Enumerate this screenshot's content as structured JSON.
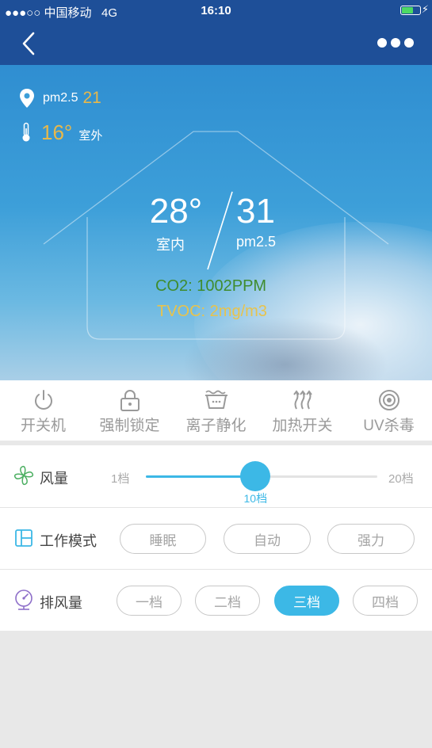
{
  "status_bar": {
    "carrier": "●●●○○ 中国移动",
    "network": "4G",
    "time": "16:10"
  },
  "nav": {
    "back_icon": "chevron-left-icon",
    "more_icon": "more-dots-icon"
  },
  "outdoor": {
    "pm_label": "pm2.5",
    "pm_value": "21",
    "temp_value": "16°",
    "temp_label": "室外"
  },
  "indoor": {
    "temp_value": "28°",
    "temp_label": "室内",
    "pm_value": "31",
    "pm_label": "pm2.5",
    "co2": "CO2: 1002PPM",
    "tvoc": "TVOC: 2mg/m3"
  },
  "toolbar": {
    "items": [
      {
        "label": "开关机",
        "icon": "power-icon"
      },
      {
        "label": "强制锁定",
        "icon": "lock-icon"
      },
      {
        "label": "离子静化",
        "icon": "ion-purify-icon"
      },
      {
        "label": "加热开关",
        "icon": "heat-icon"
      },
      {
        "label": "UV杀毒",
        "icon": "uv-icon"
      }
    ]
  },
  "fan_speed": {
    "label": "风量",
    "icon": "fan-icon",
    "min_label": "1档",
    "max_label": "20档",
    "min": 1,
    "max": 20,
    "value": 10,
    "value_label": "10档"
  },
  "work_mode": {
    "label": "工作模式",
    "icon": "mode-icon",
    "options": [
      "睡眠",
      "自动",
      "强力"
    ],
    "selected": null
  },
  "exhaust": {
    "label": "排风量",
    "icon": "gauge-icon",
    "options": [
      "一档",
      "二档",
      "三档",
      "四档"
    ],
    "selected": "三档"
  },
  "colors": {
    "nav_bg": "#1e4f98",
    "accent": "#3cb8e6",
    "warm_value": "#e8b84a",
    "co2": "#3f8c2e",
    "tvoc": "#e8c34c"
  }
}
